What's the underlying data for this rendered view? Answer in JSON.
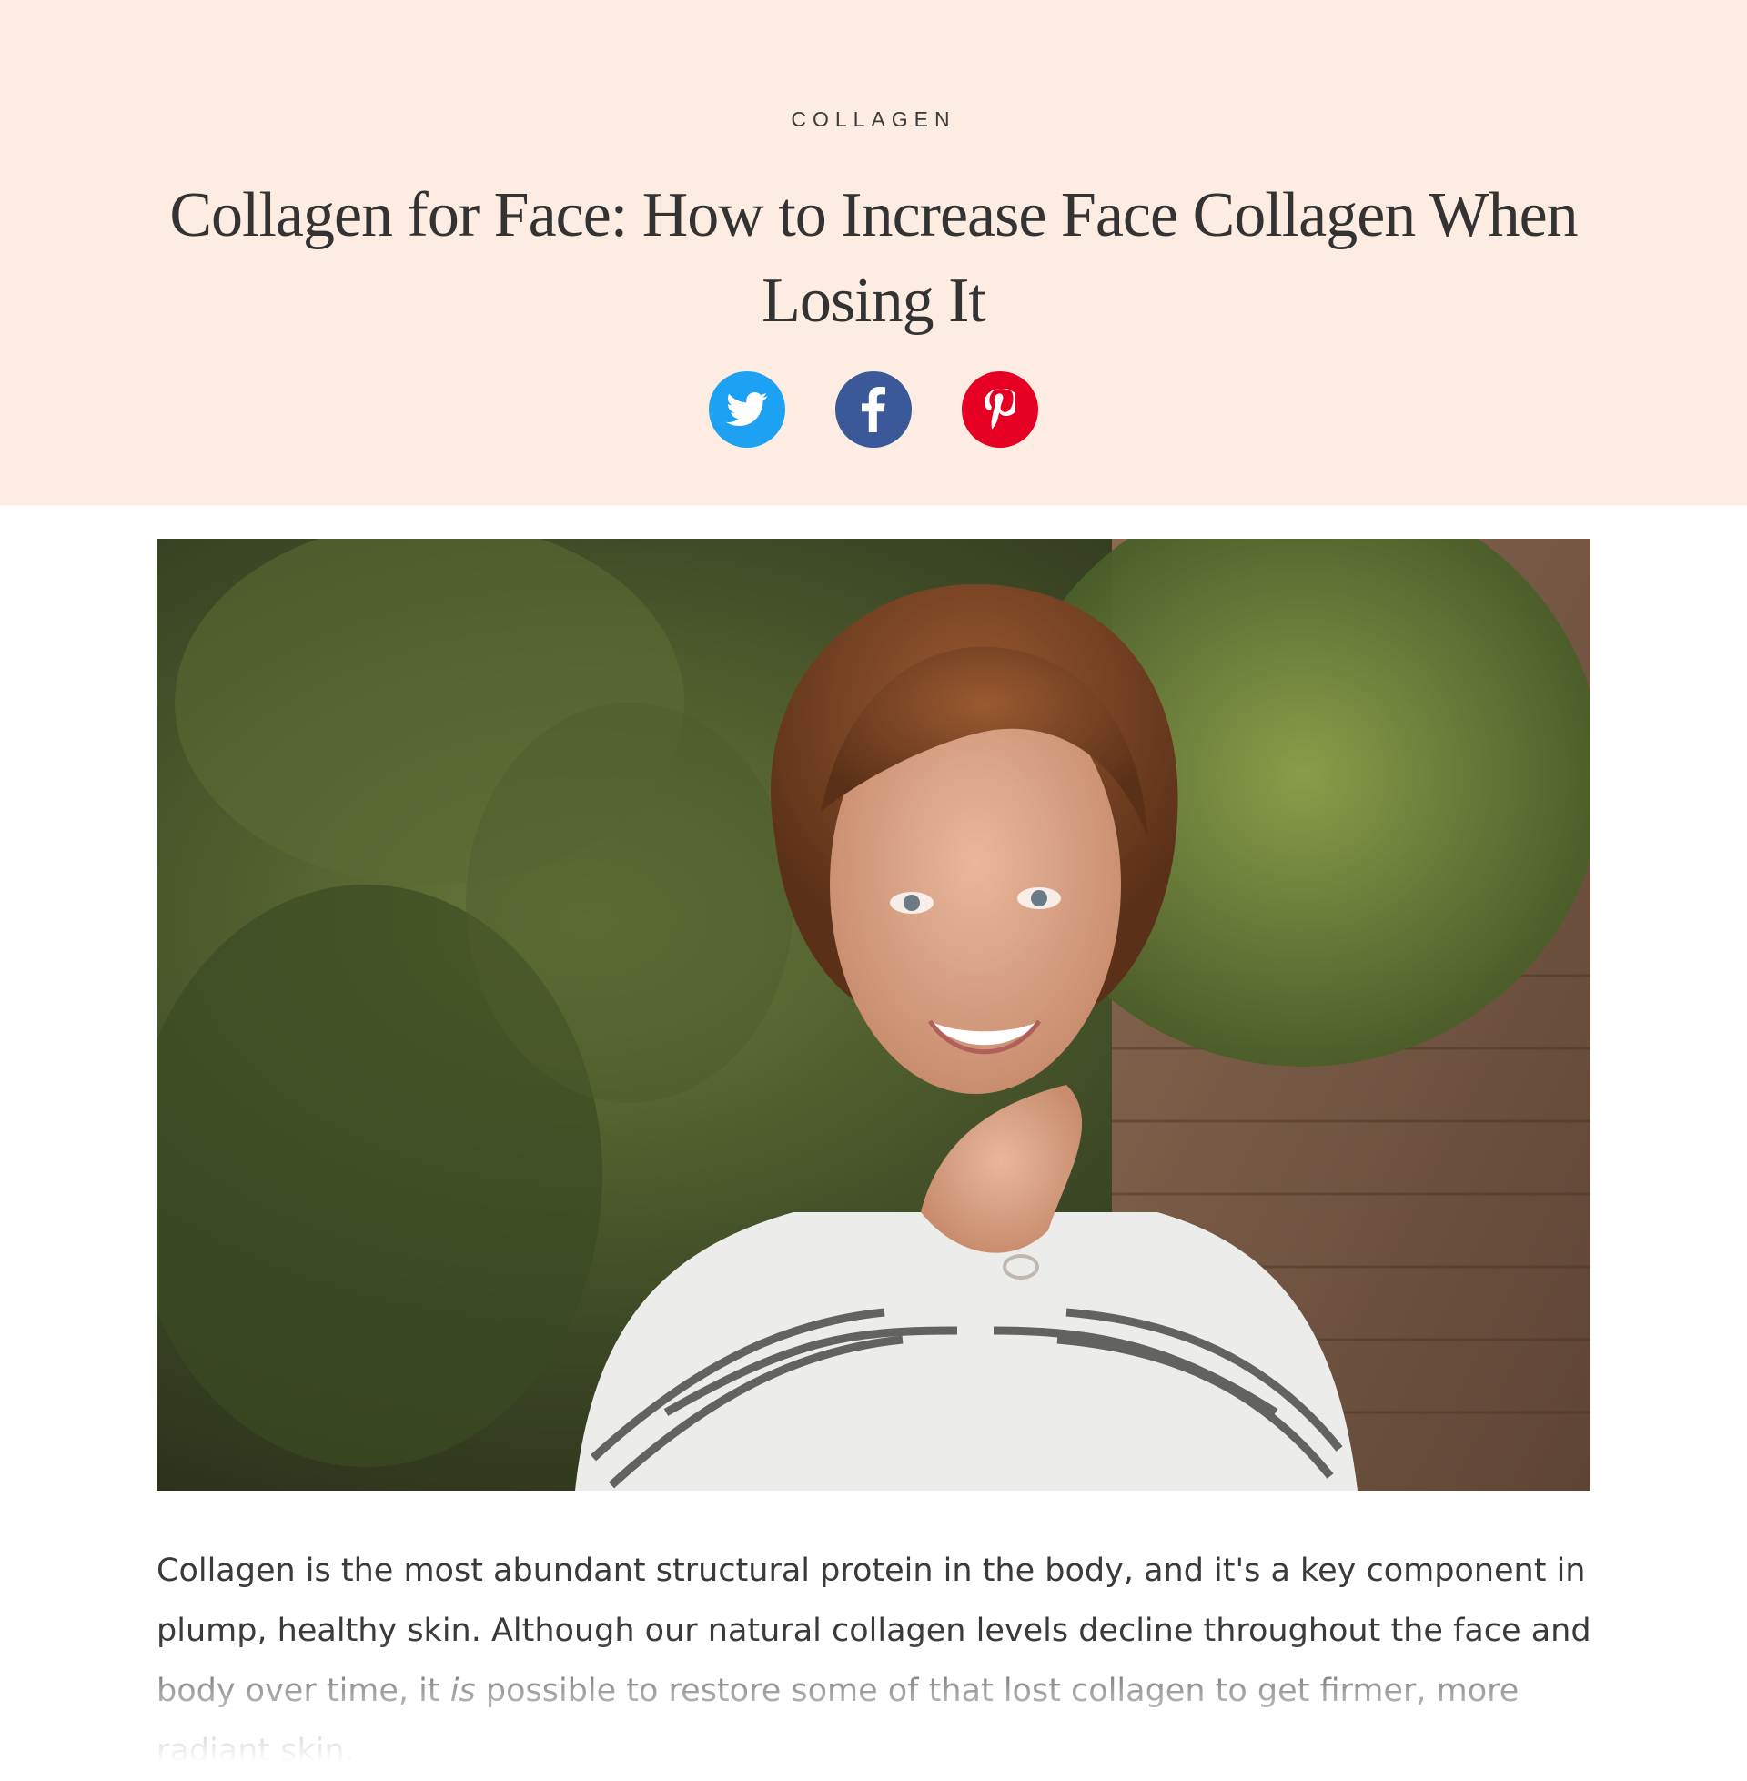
{
  "article": {
    "category": "COLLAGEN",
    "title": "Collagen for Face: How to Increase Face Collagen When Losing It",
    "intro_part1": "Collagen is the most abundant structural protein in the body, and it's a key component in plump, healthy skin. Although our natural collagen levels decline throughout the face and body over time, it ",
    "intro_emphasis": "is",
    "intro_part2": " possible to restore some of that lost collagen to get firmer, more radiant skin."
  },
  "share": {
    "twitter_icon": "twitter-icon",
    "facebook_icon": "facebook-icon",
    "pinterest_icon": "pinterest-icon",
    "twitter_color": "#1da1f2",
    "facebook_color": "#3b5998",
    "pinterest_color": "#e60023"
  },
  "colors": {
    "hero_background": "#fdece2",
    "text": "#333333"
  }
}
